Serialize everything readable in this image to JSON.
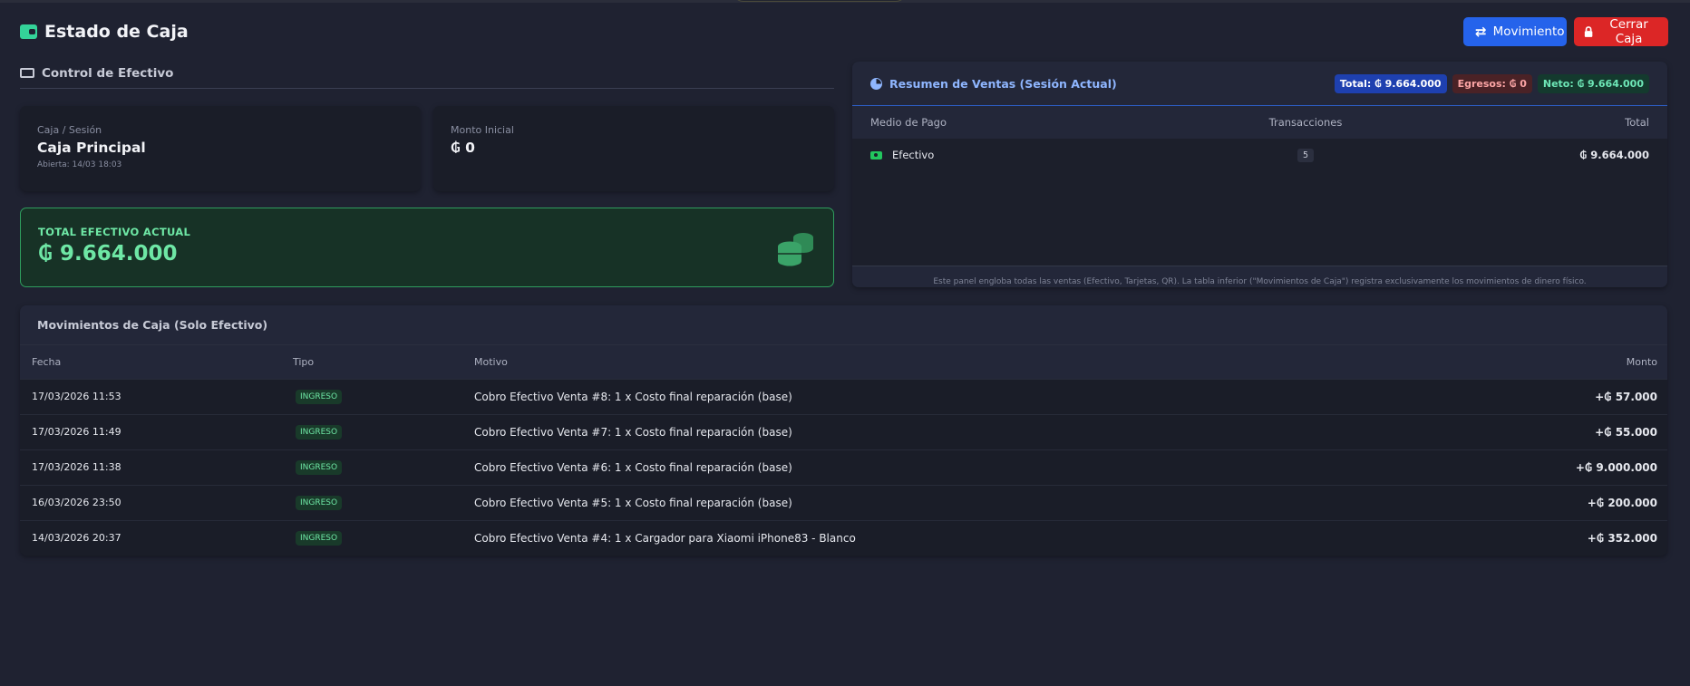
{
  "header": {
    "title": "Estado de Caja",
    "buttons": {
      "movimiento": "Movimiento",
      "cerrar": "Cerrar Caja"
    }
  },
  "control": {
    "title": "Control de Efectivo",
    "caja": {
      "label": "Caja / Sesión",
      "value": "Caja Principal",
      "opened": "Abierta: 14/03 18:03"
    },
    "monto": {
      "label": "Monto Inicial",
      "value": "₲ 0"
    },
    "total": {
      "label": "TOTAL EFECTIVO ACTUAL",
      "value": "₲ 9.664.000"
    }
  },
  "summary": {
    "title": "Resumen de Ventas (Sesión Actual)",
    "badges": {
      "total": "Total: ₲ 9.664.000",
      "egresos": "Egresos: ₲ 0",
      "neto": "Neto: ₲ 9.664.000"
    },
    "columns": [
      "Medio de Pago",
      "Transacciones",
      "Total"
    ],
    "rows": [
      {
        "method": "Efectivo",
        "count": "5",
        "total": "₲ 9.664.000"
      }
    ],
    "footer": "Este panel engloba todas las ventas (Efectivo, Tarjetas, QR). La tabla inferior (\"Movimientos de Caja\") registra exclusivamente los movimientos de dinero físico."
  },
  "movements": {
    "title": "Movimientos de Caja (Solo Efectivo)",
    "columns": [
      "Fecha",
      "Tipo",
      "Motivo",
      "Monto"
    ],
    "rows": [
      {
        "date": "17/03/2026 11:53",
        "type": "INGRESO",
        "reason": "Cobro Efectivo Venta #8: 1 x Costo final reparación (base)",
        "amount": "+₲ 57.000"
      },
      {
        "date": "17/03/2026 11:49",
        "type": "INGRESO",
        "reason": "Cobro Efectivo Venta #7: 1 x Costo final reparación (base)",
        "amount": "+₲ 55.000"
      },
      {
        "date": "17/03/2026 11:38",
        "type": "INGRESO",
        "reason": "Cobro Efectivo Venta #6: 1 x Costo final reparación (base)",
        "amount": "+₲ 9.000.000"
      },
      {
        "date": "16/03/2026 23:50",
        "type": "INGRESO",
        "reason": "Cobro Efectivo Venta #5: 1 x Costo final reparación (base)",
        "amount": "+₲ 200.000"
      },
      {
        "date": "14/03/2026 20:37",
        "type": "INGRESO",
        "reason": "Cobro Efectivo Venta #4: 1 x Cargador para Xiaomi iPhone83 - Blanco",
        "amount": "+₲ 352.000"
      }
    ]
  },
  "colors": {
    "accent": "#2563eb",
    "danger": "#dc2626",
    "success": "#34d399",
    "background": "#1f2231"
  },
  "icons": {
    "title": "wallet-icon",
    "movimiento": "exchange-icon",
    "cerrar": "lock-icon",
    "control": "money-icon",
    "summary": "pie-chart-icon",
    "cash": "cash-icon",
    "total": "coins-icon"
  }
}
